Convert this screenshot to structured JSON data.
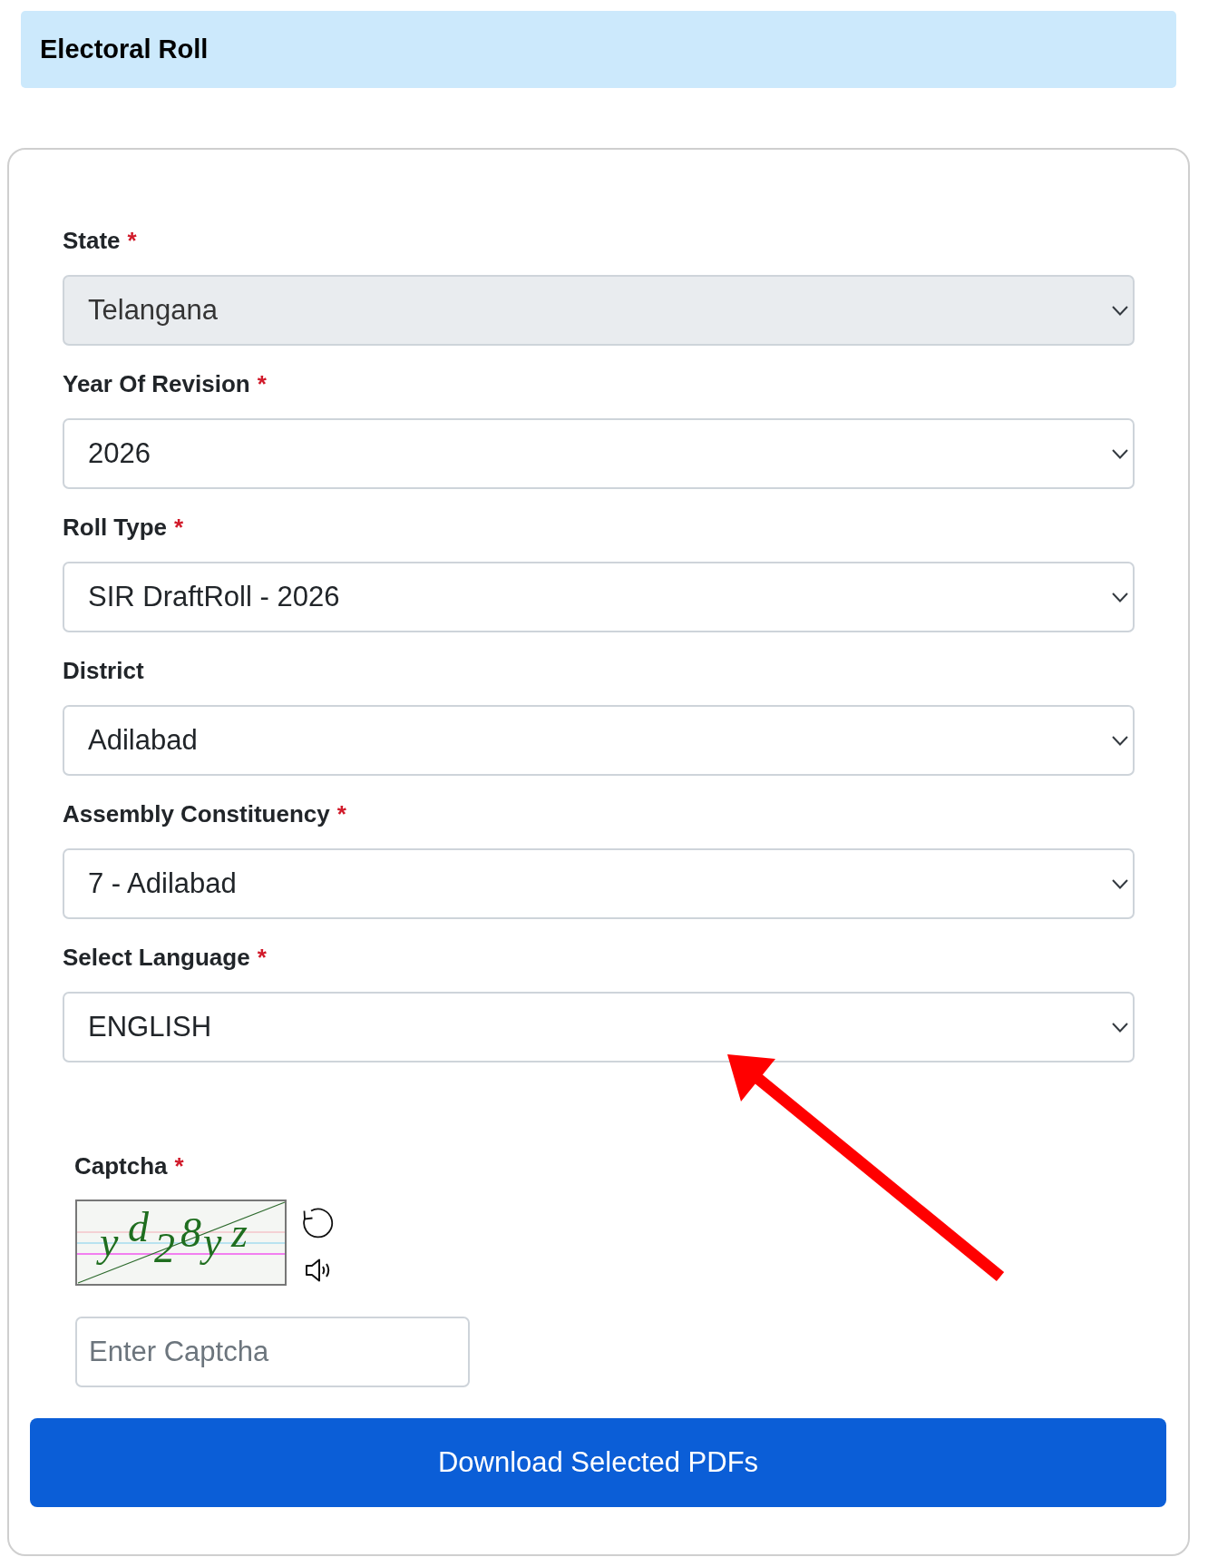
{
  "header": {
    "title": "Electoral Roll"
  },
  "form": {
    "fields": [
      {
        "label": "State",
        "required_mark": "*",
        "value": "Telangana",
        "disabled": true
      },
      {
        "label": "Year Of Revision",
        "required_mark": "*",
        "value": "2026",
        "disabled": false
      },
      {
        "label": "Roll Type",
        "required_mark": "*",
        "value": "SIR DraftRoll - 2026",
        "disabled": false
      },
      {
        "label": "District",
        "value": "Adilabad",
        "disabled": false
      },
      {
        "label": "Assembly Constituency",
        "required_mark": "*",
        "value": "7 - Adilabad",
        "disabled": false
      },
      {
        "label": "Select Language",
        "required_mark": "*",
        "value": "ENGLISH",
        "disabled": false
      }
    ],
    "captcha": {
      "label": "Captcha",
      "required_mark": "*",
      "image_text": "yd28yz",
      "placeholder": "Enter Captcha"
    },
    "submit_button": {
      "label": "Download Selected PDFs"
    }
  },
  "annotations": [
    {
      "kind": "arrow"
    }
  ]
}
